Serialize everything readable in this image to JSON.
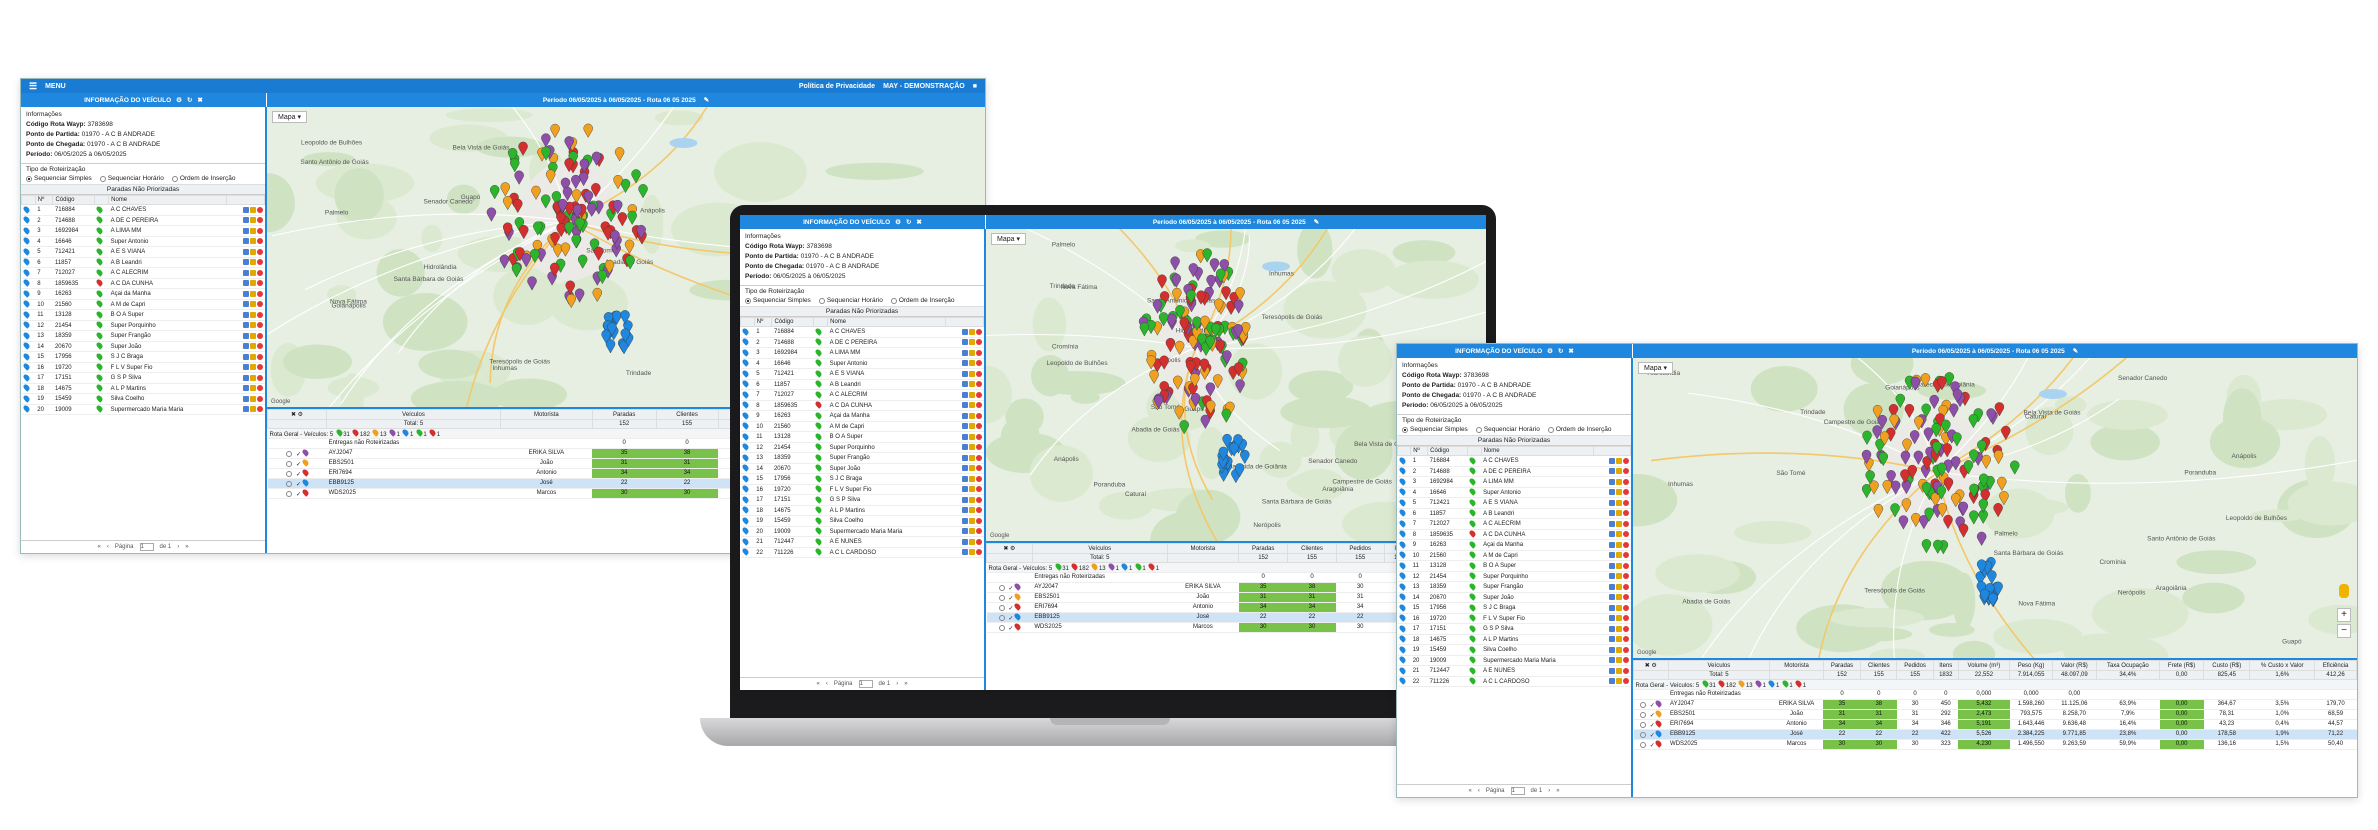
{
  "app": {
    "menu_label": "MENU",
    "privacy_link": "Política de Privacidade",
    "user_label": "MAY - DEMONSTRAÇÃO"
  },
  "header": {
    "title": "INFORMAÇÃO DO VEÍCULO",
    "period": "Período 06/05/2025 à 06/05/2025 - Rota 06 05 2025"
  },
  "info": {
    "label": "Informações",
    "route_code_label": "Código Rota Wayp:",
    "route_code_value": "3783698",
    "start_label": "Ponto de Partida:",
    "start_value": "01970 - A C B ANDRADE",
    "end_label": "Ponto de Chegada:",
    "end_value": "01970 - A C B ANDRADE",
    "period_label": "Período:",
    "period_value": "06/05/2025 à 06/05/2025"
  },
  "routing": {
    "title": "Tipo de Roteirização",
    "options": [
      "Sequenciar Simples",
      "Sequenciar Horário",
      "Ordem de Inserção"
    ]
  },
  "stops_title": "Paradas Não Priorizadas",
  "stops_columns": [
    "Nº",
    "Código",
    "Nome"
  ],
  "stops": [
    [
      "1",
      "716884",
      "A C CHAVES"
    ],
    [
      "2",
      "714688",
      "A DE C PEREIRA"
    ],
    [
      "3",
      "1692984",
      "A LIMA MM"
    ],
    [
      "4",
      "16646",
      "Super Antonio"
    ],
    [
      "5",
      "712421",
      "A E S VIANA"
    ],
    [
      "6",
      "11857",
      "A B Leandri"
    ],
    [
      "7",
      "712027",
      "A C ALECRIM"
    ],
    [
      "8",
      "1859635",
      "A C DA CUNHA"
    ],
    [
      "9",
      "16263",
      "Açai da Manha"
    ],
    [
      "10",
      "21560",
      "A M de Capri"
    ],
    [
      "11",
      "13128",
      "B O A Super"
    ],
    [
      "12",
      "21454",
      "Super Porquinho"
    ],
    [
      "13",
      "18359",
      "Super Frangão"
    ],
    [
      "14",
      "20670",
      "Super João"
    ],
    [
      "15",
      "17956",
      "S J C Braga"
    ],
    [
      "16",
      "19720",
      "F L V Super Fio"
    ],
    [
      "17",
      "17151",
      "G S P Silva"
    ],
    [
      "18",
      "14675",
      "A L P Martins"
    ],
    [
      "19",
      "15459",
      "Silva Coelho"
    ],
    [
      "20",
      "19009",
      "Supermercado Maria Maria"
    ],
    [
      "21",
      "712447",
      "A E NUNES"
    ],
    [
      "22",
      "711226",
      "A C L CARDOSO"
    ]
  ],
  "pager": {
    "page_label": "Página",
    "page_value": "1",
    "of_label": "de 1"
  },
  "map": {
    "label": "Mapa",
    "google": "Google",
    "places": [
      "Santa Bárbara de Goiás",
      "Caturaí",
      "Inhumas",
      "Nerópolis",
      "Santo Antônio de Goiás",
      "Goianápolis",
      "Trindade",
      "Senador Canedo",
      "Bela Vista de Goiás",
      "Aparecida de Goiânia",
      "Aragoiânia",
      "Hidrolândia",
      "Nova Fátima",
      "Campestre de Goiás",
      "Guapó",
      "Abadia de Goiás",
      "Palmelo",
      "Poranduba",
      "São Tomé",
      "Anápolis",
      "Leopoldo de Bulhões",
      "Teresópolis de Goiás",
      "Cromínia"
    ]
  },
  "vehicles": {
    "columns": [
      "Veículos",
      "Motorista",
      "Paradas",
      "Clientes",
      "Pedidos",
      "Itens",
      "Volume (m³)",
      "Peso (Kg)",
      "Valor (R$)",
      "Taxa Ocupação",
      "Frete (R$)",
      "Custo (R$)",
      "% Custo x Valor",
      "Eficiência"
    ],
    "totals": [
      "Total: 5",
      "",
      "152",
      "155",
      "155",
      "1832",
      "22,552",
      "7.914,055",
      "48.097,09",
      "34,4%",
      "0,00",
      "825,45",
      "1,6%",
      "412,26"
    ],
    "legend_label": "Rota Geral - Veículos: 5",
    "legend_counts": [
      "31",
      "182",
      "13",
      "1",
      "1",
      "1",
      "1"
    ],
    "unrouted_label": "Entregas não Roteirizadas",
    "unrouted": [
      "",
      "0",
      "0",
      "0",
      "0",
      "0,000",
      "0,000",
      "0,00",
      "",
      "",
      "",
      "",
      ""
    ],
    "rows": [
      [
        "AYJ2047",
        "ERIKA SILVA",
        "35",
        "38",
        "30",
        "450",
        "5,432",
        "1.598,260",
        "11.125,06",
        "63,9%",
        "0,00",
        "364,67",
        "3,5%",
        "179,70"
      ],
      [
        "EBS2501",
        "João",
        "31",
        "31",
        "31",
        "292",
        "2,473",
        "793,575",
        "8.258,70",
        "7,9%",
        "0,00",
        "78,31",
        "1,0%",
        "68,59"
      ],
      [
        "ERI7694",
        "Antonio",
        "34",
        "34",
        "34",
        "346",
        "5,191",
        "1.643,446",
        "9.636,48",
        "16,4%",
        "0,00",
        "43,23",
        "0,4%",
        "44,57"
      ],
      [
        "EBB9125",
        "José",
        "22",
        "22",
        "22",
        "422",
        "5,526",
        "2.384,225",
        "9.771,85",
        "23,8%",
        "0,00",
        "178,58",
        "1,9%",
        "71,22"
      ],
      [
        "WDS2025",
        "Marcos",
        "30",
        "30",
        "30",
        "323",
        "4,230",
        "1.496,550",
        "9.263,59",
        "59,9%",
        "0,00",
        "136,16",
        "1,5%",
        "50,40"
      ]
    ]
  }
}
